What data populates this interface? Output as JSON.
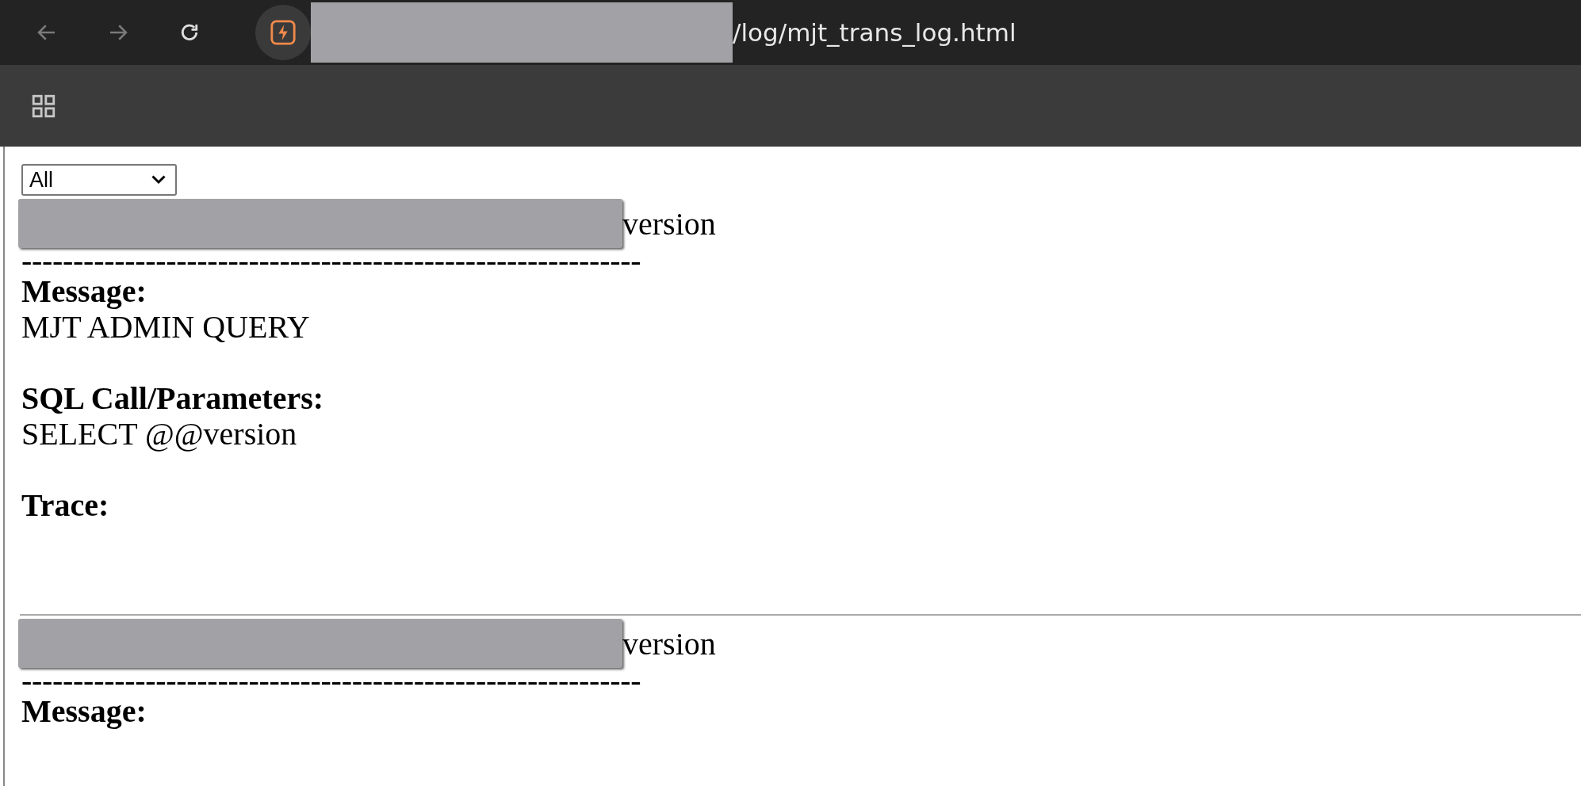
{
  "browser": {
    "url": "/log/mjt_trans_log.html"
  },
  "filter": {
    "value": "All"
  },
  "entries": [
    {
      "title": "version",
      "separator": "------------------------------------------------------------",
      "message_label": "Message:",
      "message": "MJT ADMIN QUERY",
      "sql_label": "SQL Call/Parameters:",
      "sql": "SELECT @@version",
      "trace_label": "Trace:"
    },
    {
      "title": "version",
      "separator": "------------------------------------------------------------",
      "message_label": "Message:"
    }
  ]
}
